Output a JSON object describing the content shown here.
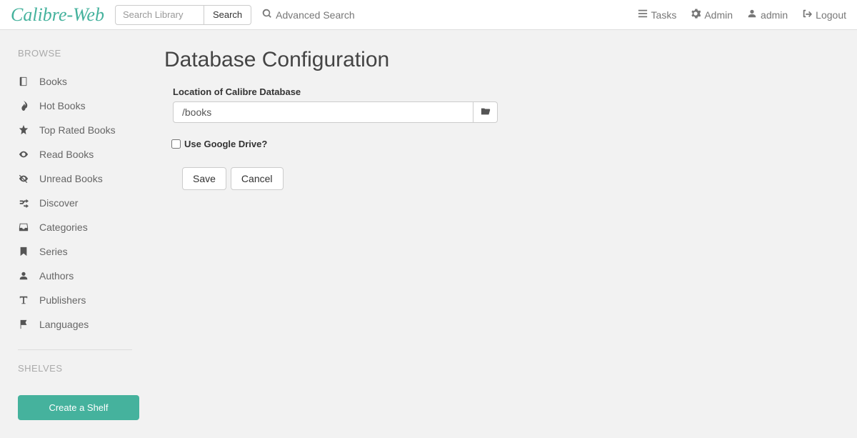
{
  "brand": "Calibre-Web",
  "search": {
    "placeholder": "Search Library",
    "button": "Search"
  },
  "advanced_search": "Advanced Search",
  "top_nav": {
    "tasks": "Tasks",
    "admin": "Admin",
    "user": "admin",
    "logout": "Logout"
  },
  "sidebar": {
    "browse_heading": "BROWSE",
    "items": [
      {
        "label": "Books"
      },
      {
        "label": "Hot Books"
      },
      {
        "label": "Top Rated Books"
      },
      {
        "label": "Read Books"
      },
      {
        "label": "Unread Books"
      },
      {
        "label": "Discover"
      },
      {
        "label": "Categories"
      },
      {
        "label": "Series"
      },
      {
        "label": "Authors"
      },
      {
        "label": "Publishers"
      },
      {
        "label": "Languages"
      }
    ],
    "shelves_heading": "SHELVES",
    "create_shelf": "Create a Shelf"
  },
  "main": {
    "title": "Database Configuration",
    "db_location_label": "Location of Calibre Database",
    "db_location_value": "/books",
    "gdrive_label": "Use Google Drive?",
    "save": "Save",
    "cancel": "Cancel"
  }
}
